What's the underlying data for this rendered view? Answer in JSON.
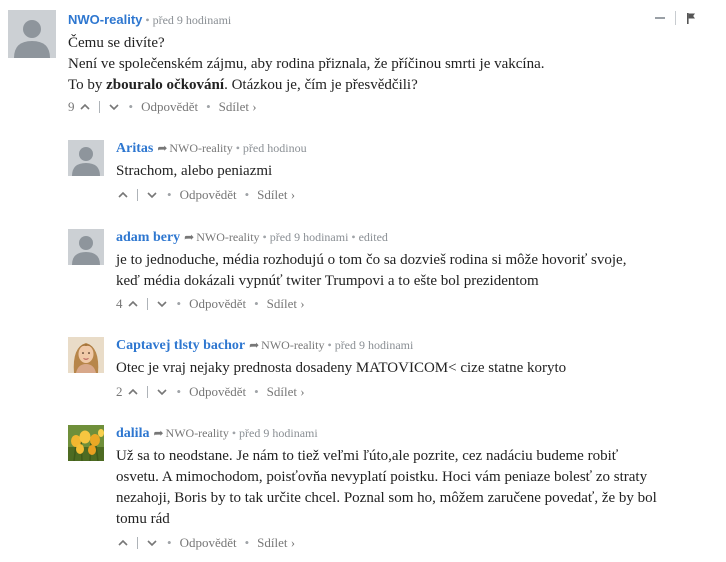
{
  "comments": [
    {
      "author": "NWO-reality",
      "time": "před 9 hodinami",
      "lines": [
        [
          "Čemu se divíte?"
        ],
        [
          "Není ve společenském zájmu, aby rodina přiznala, že příčinou smrti je vakcína."
        ],
        [
          "To by ",
          "zbouralo očkování",
          ". Otázkou je, čím je přesvědčili?"
        ]
      ],
      "votes": "9",
      "reply_label": "Odpovědět",
      "share_label": "Sdílet ›"
    },
    {
      "author": "Aritas",
      "parent": "NWO-reality",
      "time": "před hodinou",
      "lines": [
        [
          "Strachom, alebo peniazmi"
        ]
      ],
      "votes": "",
      "reply_label": "Odpovědět",
      "share_label": "Sdílet ›"
    },
    {
      "author": "adam bery",
      "parent": "NWO-reality",
      "time": "před 9 hodinami",
      "edited": "edited",
      "lines": [
        [
          "je to jednoduche, média rozhodujú o tom čo sa dozvieš rodina si môže hovoriť svoje,"
        ],
        [
          "keď média dokázali vypnúť twiter Trumpovi a to ešte bol prezidentom"
        ]
      ],
      "votes": "4",
      "reply_label": "Odpovědět",
      "share_label": "Sdílet ›"
    },
    {
      "author": "Captavej tlsty bachor",
      "parent": "NWO-reality",
      "time": "před 9 hodinami",
      "lines": [
        [
          "Otec je vraj nejaky prednosta dosadeny MATOVICOM< cize statne koryto"
        ]
      ],
      "votes": "2",
      "reply_label": "Odpovědět",
      "share_label": "Sdílet ›"
    },
    {
      "author": "dalila",
      "parent": "NWO-reality",
      "time": "před 9 hodinami",
      "lines": [
        [
          "Už sa to neodstane. Je nám to tiež veľmi ľúto,ale pozrite, cez nadáciu budeme robiť"
        ],
        [
          "osvetu. A mimochodom, poisťovňa nevyplatí poistku. Hoci vám peniaze bolesť zo straty"
        ],
        [
          "nezahoji, Boris by to tak určite chcel. Poznal som ho, môžem zaručene povedať, že by bol"
        ],
        [
          "tomu rád"
        ]
      ],
      "votes": "",
      "reply_label": "Odpovědět",
      "share_label": "Sdílet ›"
    }
  ],
  "icons": {
    "upvote": "chevron-up-icon",
    "downvote": "chevron-down-icon",
    "reply_arrow": "share-arrow-icon",
    "minimize": "minimize-icon",
    "flag": "flag-icon"
  },
  "colors": {
    "author": "#2e77d0",
    "meta": "#8a8f94",
    "text": "#222222"
  }
}
